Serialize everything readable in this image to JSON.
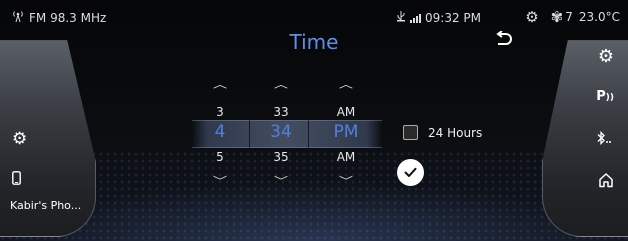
{
  "status": {
    "radio": "FM 98.3 MHz",
    "time": "09:32 PM",
    "fan_speed": "7",
    "temperature": "23.0°C"
  },
  "title": "Time",
  "picker": {
    "hour": {
      "prev": "3",
      "selected": "4",
      "next": "5"
    },
    "minute": {
      "prev": "33",
      "selected": "34",
      "next": "35"
    },
    "period": {
      "prev": "AM",
      "selected": "PM",
      "next": "AM"
    }
  },
  "options": {
    "hours24_label": "24 Hours",
    "hours24_checked": false
  },
  "left_panel": {
    "phone_label": "Kabir's Pho..."
  },
  "colors": {
    "accent": "#5f8de8",
    "selected_value": "#4f80e0"
  },
  "icons": [
    "antenna-icon",
    "usb-icon",
    "signal-icon",
    "settings-icon",
    "fan-icon",
    "back-icon",
    "phone-icon",
    "check-icon",
    "parking-sensor-icon",
    "bluetooth-icon",
    "home-icon"
  ]
}
